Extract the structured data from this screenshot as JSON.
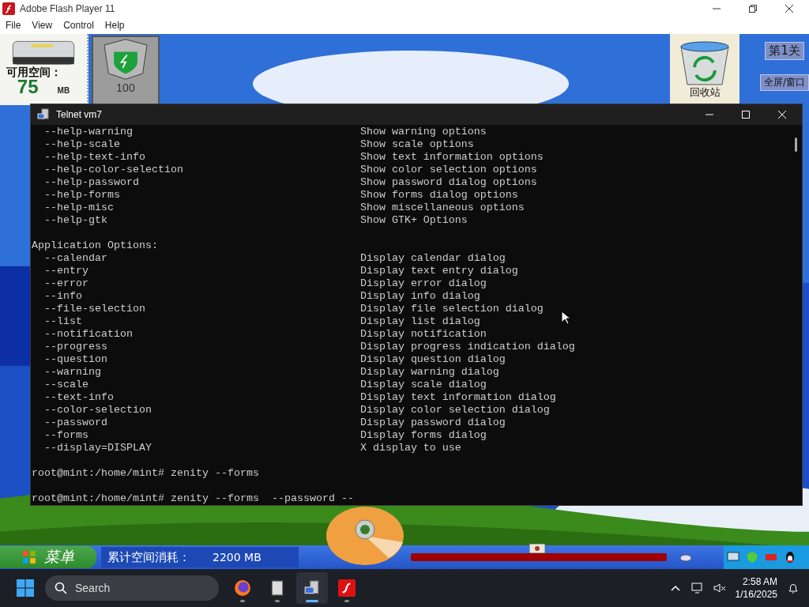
{
  "window": {
    "title": "Adobe Flash Player 11"
  },
  "menu": [
    "File",
    "View",
    "Control",
    "Help"
  ],
  "game": {
    "disk": {
      "label": "可用空间：",
      "value": "75",
      "unit": "MB"
    },
    "shield": {
      "value": "100"
    },
    "recycle": {
      "label": "回收站"
    },
    "level_button": "第1关",
    "screen_button": "全屏/窗口",
    "bottom_bar": {
      "start": "菜单",
      "usage_label": "累计空间消耗：",
      "usage_value": "2200 MB",
      "progress": {
        "level": 1.0
      }
    }
  },
  "terminal": {
    "title": "Telnet vm7",
    "lines": [
      {
        "kind": "option",
        "flag": "--help-warning",
        "desc": "Show warning options"
      },
      {
        "kind": "option",
        "flag": "--help-scale",
        "desc": "Show scale options"
      },
      {
        "kind": "option",
        "flag": "--help-text-info",
        "desc": "Show text information options"
      },
      {
        "kind": "option",
        "flag": "--help-color-selection",
        "desc": "Show color selection options"
      },
      {
        "kind": "option",
        "flag": "--help-password",
        "desc": "Show password dialog options"
      },
      {
        "kind": "option",
        "flag": "--help-forms",
        "desc": "Show forms dialog options"
      },
      {
        "kind": "option",
        "flag": "--help-misc",
        "desc": "Show miscellaneous options"
      },
      {
        "kind": "option",
        "flag": "--help-gtk",
        "desc": "Show GTK+ Options"
      },
      {
        "kind": "blank"
      },
      {
        "kind": "heading",
        "text": "Application Options:"
      },
      {
        "kind": "option",
        "flag": "--calendar",
        "desc": "Display calendar dialog"
      },
      {
        "kind": "option",
        "flag": "--entry",
        "desc": "Display text entry dialog"
      },
      {
        "kind": "option",
        "flag": "--error",
        "desc": "Display error dialog"
      },
      {
        "kind": "option",
        "flag": "--info",
        "desc": "Display info dialog"
      },
      {
        "kind": "option",
        "flag": "--file-selection",
        "desc": "Display file selection dialog"
      },
      {
        "kind": "option",
        "flag": "--list",
        "desc": "Display list dialog"
      },
      {
        "kind": "option",
        "flag": "--notification",
        "desc": "Display notification"
      },
      {
        "kind": "option",
        "flag": "--progress",
        "desc": "Display progress indication dialog"
      },
      {
        "kind": "option",
        "flag": "--question",
        "desc": "Display question dialog"
      },
      {
        "kind": "option",
        "flag": "--warning",
        "desc": "Display warning dialog"
      },
      {
        "kind": "option",
        "flag": "--scale",
        "desc": "Display scale dialog"
      },
      {
        "kind": "option",
        "flag": "--text-info",
        "desc": "Display text information dialog"
      },
      {
        "kind": "option",
        "flag": "--color-selection",
        "desc": "Display color selection dialog"
      },
      {
        "kind": "option",
        "flag": "--password",
        "desc": "Display password dialog"
      },
      {
        "kind": "option",
        "flag": "--forms",
        "desc": "Display forms dialog"
      },
      {
        "kind": "option",
        "flag": "--display=DISPLAY",
        "desc": "X display to use"
      },
      {
        "kind": "blank"
      },
      {
        "kind": "prompt",
        "text": "root@mint:/home/mint# zenity --forms"
      },
      {
        "kind": "blank"
      },
      {
        "kind": "prompt",
        "text": "root@mint:/home/mint# zenity --forms  --password --"
      }
    ]
  },
  "taskbar": {
    "search": {
      "placeholder": "Search"
    },
    "apps": [
      {
        "selected": false
      },
      {
        "selected": false
      },
      {
        "selected": true
      },
      {
        "selected": false
      }
    ],
    "time": "2:58 AM",
    "date": "1/16/2025"
  }
}
